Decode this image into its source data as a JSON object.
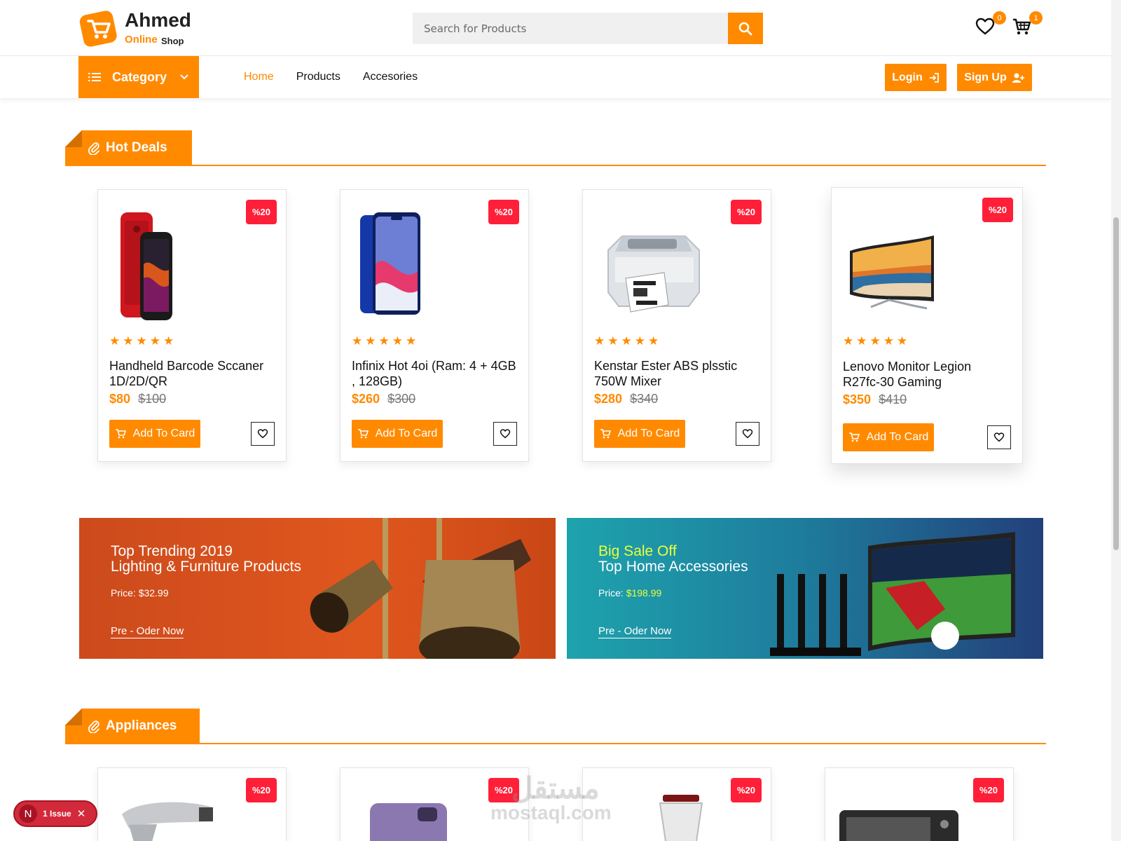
{
  "header": {
    "logo": {
      "name": "Ahmed",
      "sub_online": "Online",
      "sub_shop": "Shop"
    },
    "search": {
      "placeholder": "Search for Products",
      "value": ""
    },
    "wishlist_count": "0",
    "cart_count": "1"
  },
  "nav": {
    "category_label": "Category",
    "links": [
      "Home",
      "Products",
      "Accesories"
    ],
    "login_label": "Login",
    "signup_label": "Sign Up"
  },
  "hot_deals": {
    "title": "Hot Deals",
    "products": [
      {
        "name": "Handheld Barcode Sccaner 1D/2D/QR",
        "price": "$80",
        "old_price": "$100",
        "badge": "%20",
        "rating": 5,
        "image": "red-smartphone"
      },
      {
        "name": "Infinix Hot 4oi (Ram: 4 + 4GB , 128GB)",
        "price": "$260",
        "old_price": "$300",
        "badge": "%20",
        "rating": 5,
        "image": "blue-smartphone"
      },
      {
        "name": "Kenstar Ester ABS plsstic 750W Mixer",
        "price": "$280",
        "old_price": "$340",
        "badge": "%20",
        "rating": 5,
        "image": "label-printer"
      },
      {
        "name": "Lenovo Monitor Legion R27fc-30 Gaming",
        "price": "$350",
        "old_price": "$410",
        "badge": "%20",
        "rating": 5,
        "image": "curved-tv"
      }
    ],
    "add_label": "Add To Card"
  },
  "banners": [
    {
      "line1": "Top Trending 2019",
      "line2": "Lighting & Furniture Products",
      "price_label": "Price: ",
      "price": "$32.99",
      "cta": "Pre - Oder Now",
      "color": "#d4471a"
    },
    {
      "line1": "Big Sale Off",
      "line2": "Top Home Accessories",
      "price_label": "Price: ",
      "price": "$198.99",
      "cta": "Pre - Oder Now",
      "color": "#1e9aa8"
    }
  ],
  "appliances": {
    "title": "Appliances",
    "badges": [
      "%20",
      "%20",
      "%20",
      "%20"
    ]
  },
  "issue_pill": {
    "letter": "N",
    "label": "1 Issue"
  },
  "watermark": {
    "arabic": "مستقل",
    "latin": "mostaql.com"
  },
  "colors": {
    "accent": "#ff8a00",
    "badge": "#ff1f38"
  }
}
